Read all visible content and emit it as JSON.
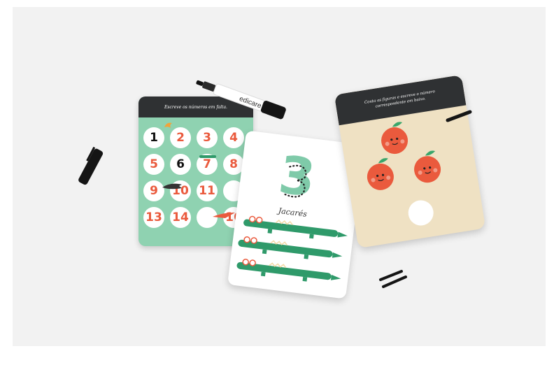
{
  "card_grid": {
    "header": "Escreve os números em falta.",
    "cells": [
      {
        "text": "1",
        "color": "#111111"
      },
      {
        "text": "2",
        "color": "#ea5a3d"
      },
      {
        "text": "3",
        "color": "#ea5a3d"
      },
      {
        "text": "4",
        "color": "#ea5a3d"
      },
      {
        "text": "5",
        "color": "#ea5a3d"
      },
      {
        "text": "6",
        "color": "#111111"
      },
      {
        "text": "7",
        "color": "#ea5a3d"
      },
      {
        "text": "8",
        "color": "#ea5a3d"
      },
      {
        "text": "9",
        "color": "#ea5a3d"
      },
      {
        "text": "10",
        "color": "#ea5a3d"
      },
      {
        "text": "11",
        "color": "#ea5a3d"
      },
      {
        "text": "",
        "color": "#ea5a3d"
      },
      {
        "text": "13",
        "color": "#ea5a3d"
      },
      {
        "text": "14",
        "color": "#ea5a3d"
      },
      {
        "text": "",
        "color": "#ea5a3d"
      },
      {
        "text": "16",
        "color": "#ea5a3d"
      }
    ]
  },
  "card_number": {
    "number": "3",
    "label": "Jacarés"
  },
  "card_oranges": {
    "header": "Conta as figuras e escreve o número correspondente em baixo."
  },
  "marker": {
    "brand": "edicare"
  },
  "colors": {
    "mint": "#8fd2b1",
    "coral": "#ea5a3d",
    "crocodile": "#2f9a6a",
    "header_dark": "#2f3133",
    "sand": "#efe1c3"
  }
}
